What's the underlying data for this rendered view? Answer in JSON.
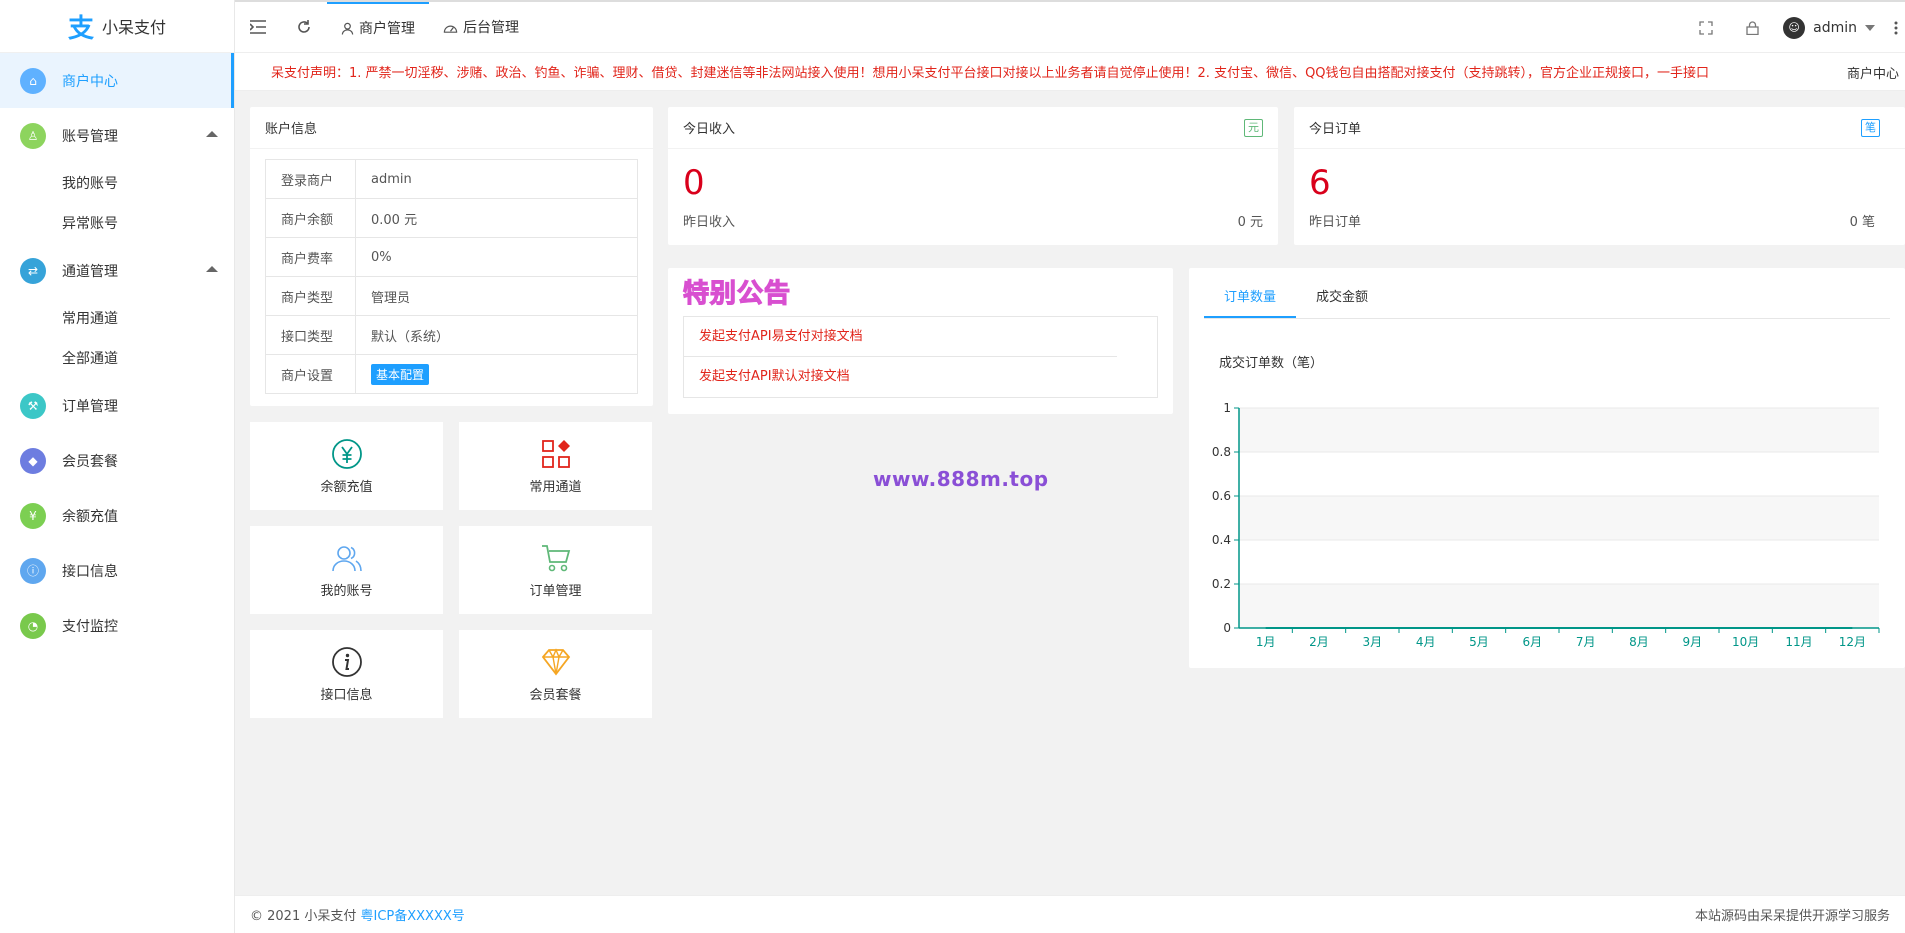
{
  "app": {
    "logo_glyph": "支",
    "name": "小呆支付"
  },
  "sidebar": {
    "items": [
      {
        "label": "商户中心",
        "color": "#5fb1ff",
        "icon": "home-icon",
        "glyph": "⌂"
      },
      {
        "label": "账号管理",
        "color": "#8dd45e",
        "icon": "user-icon",
        "glyph": "♙"
      },
      {
        "label": "通道管理",
        "color": "#36a3d9",
        "icon": "channel-icon",
        "glyph": "⇄"
      },
      {
        "label": "订单管理",
        "color": "#3cc7c7",
        "icon": "cart-icon",
        "glyph": "⚒"
      },
      {
        "label": "会员套餐",
        "color": "#6d7de0",
        "icon": "diamond-icon",
        "glyph": "◆"
      },
      {
        "label": "余额充值",
        "color": "#7ccf52",
        "icon": "yen-icon",
        "glyph": "¥"
      },
      {
        "label": "接口信息",
        "color": "#5fa7ef",
        "icon": "info-icon",
        "glyph": "ⓘ"
      },
      {
        "label": "支付监控",
        "color": "#79c94c",
        "icon": "gauge-icon",
        "glyph": "◔"
      }
    ],
    "account_sub": [
      "我的账号",
      "异常账号"
    ],
    "channel_sub": [
      "常用通道",
      "全部通道"
    ]
  },
  "header": {
    "tabs": [
      "商户管理",
      "后台管理"
    ],
    "user": "admin"
  },
  "marquee": {
    "text": "呆支付声明：1. 严禁一切淫秽、涉赌、政治、钓鱼、诈骗、理财、借贷、封建迷信等非法网站接入使用！想用小呆支付平台接口对接以上业务者请自觉停止使用！2. 支付宝、微信、QQ钱包自由搭配对接支付（支持跳转），官方企业正规接口，一手接口",
    "right": "商户中心"
  },
  "account": {
    "title": "账户信息",
    "rows": [
      {
        "k": "登录商户",
        "v": "admin"
      },
      {
        "k": "商户余额",
        "v": "0.00 元"
      },
      {
        "k": "商户费率",
        "v": "0%"
      },
      {
        "k": "商户类型",
        "v": "管理员"
      },
      {
        "k": "接口类型",
        "v": "默认（系统）"
      }
    ],
    "setting_label": "商户设置",
    "setting_button": "基本配置"
  },
  "today_income": {
    "title": "今日收入",
    "badge": "元",
    "value": "0",
    "sub_label": "昨日收入",
    "sub_value": "0 元"
  },
  "today_orders": {
    "title": "今日订单",
    "badge": "笔",
    "value": "6",
    "sub_label": "昨日订单",
    "sub_value": "0 笔"
  },
  "tiles": [
    "余额充值",
    "常用通道",
    "我的账号",
    "订单管理",
    "接口信息",
    "会员套餐"
  ],
  "notice": {
    "title": "特别公告",
    "links": [
      "发起支付API易支付对接文档",
      "发起支付API默认对接文档"
    ]
  },
  "watermark": "www.888m.top",
  "chart_tabs": [
    "订单数量",
    "成交金额"
  ],
  "chart_data": {
    "type": "line",
    "title": "成交订单数（笔）",
    "categories": [
      "1月",
      "2月",
      "3月",
      "4月",
      "5月",
      "6月",
      "7月",
      "8月",
      "9月",
      "10月",
      "11月",
      "12月"
    ],
    "values": [
      0,
      0,
      0,
      0,
      0,
      0,
      0,
      0,
      0,
      0,
      0,
      0
    ],
    "ylim": [
      0,
      1
    ],
    "yticks": [
      "0",
      "0.2",
      "0.4",
      "0.6",
      "0.8",
      "1"
    ],
    "color": "#009688",
    "grid": true
  },
  "footer": {
    "left": "© 2021 小呆支付",
    "icp": "粤ICP备XXXXX号",
    "right": "本站源码由呆呆提供开源学习服务"
  }
}
